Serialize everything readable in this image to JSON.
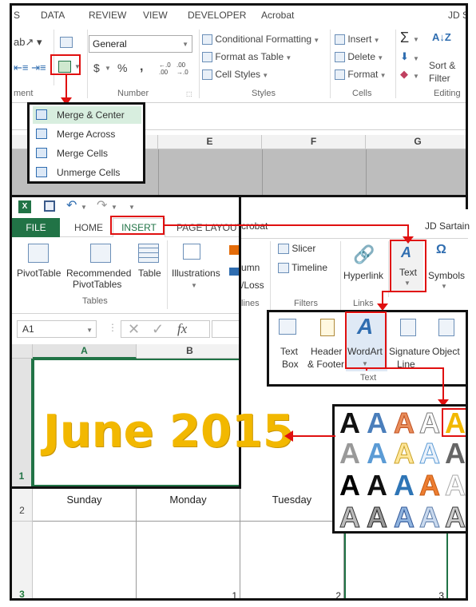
{
  "ribbon_top": {
    "tabs": [
      "S",
      "DATA",
      "REVIEW",
      "VIEW",
      "DEVELOPER",
      "Acrobat",
      "JD Sa"
    ],
    "number_format": "General",
    "currency": "$",
    "percent": "%",
    "comma": ",",
    "dec_inc": "←.0 .00",
    "dec_dec": ".00 →.0",
    "cond_format": "Conditional Formatting",
    "format_table": "Format as Table",
    "cell_styles": "Cell Styles",
    "insert": "Insert",
    "delete": "Delete",
    "format": "Format",
    "sort_filter_1": "Sort &",
    "sort_filter_2": "Filter",
    "groups": [
      "ment",
      "Number",
      "Styles",
      "Cells",
      "Editing"
    ]
  },
  "top_cols": [
    "E",
    "F",
    "G"
  ],
  "merge_menu": [
    "Merge & Center",
    "Merge Across",
    "Merge Cells",
    "Unmerge Cells"
  ],
  "insert_window": {
    "tabs": [
      "FILE",
      "HOME",
      "INSERT",
      "PAGE LAYOUT"
    ],
    "acrobat_tail": "crobat",
    "user": "JD Sartain",
    "pivot": "PivotTable",
    "rec_pivot_1": "Recommended",
    "rec_pivot_2": "PivotTables",
    "table": "Table",
    "tables_group": "Tables",
    "illustrations": "Illustrations",
    "partial_1": "umn",
    "partial_2": "/Loss",
    "partial_3": "lines",
    "slicer": "Slicer",
    "timeline": "Timeline",
    "filters_group": "Filters",
    "hyperlink": "Hyperlink",
    "links_group": "Links",
    "text": "Text",
    "symbols": "Symbols",
    "name_box": "A1",
    "fx": "fx",
    "col_a": "A",
    "col_b": "B",
    "row_1": "1"
  },
  "text_panel": {
    "items": [
      {
        "l1": "Text",
        "l2": "Box"
      },
      {
        "l1": "Header",
        "l2": "& Footer"
      },
      {
        "l1": "WordArt",
        "l2": ""
      },
      {
        "l1": "Signature",
        "l2": "Line"
      },
      {
        "l1": "Object",
        "l2": ""
      }
    ],
    "group": "Text"
  },
  "wordart_glyph": "A",
  "title": "June 2015",
  "calendar": {
    "days": [
      "Sunday",
      "Monday",
      "Tuesday"
    ],
    "row_2": "2",
    "row_3": "3",
    "dates": [
      "1",
      "2",
      "3"
    ]
  },
  "colors": {
    "accent_green": "#217346",
    "title_gold": "#f2b800",
    "highlight_red": "#e01010"
  }
}
